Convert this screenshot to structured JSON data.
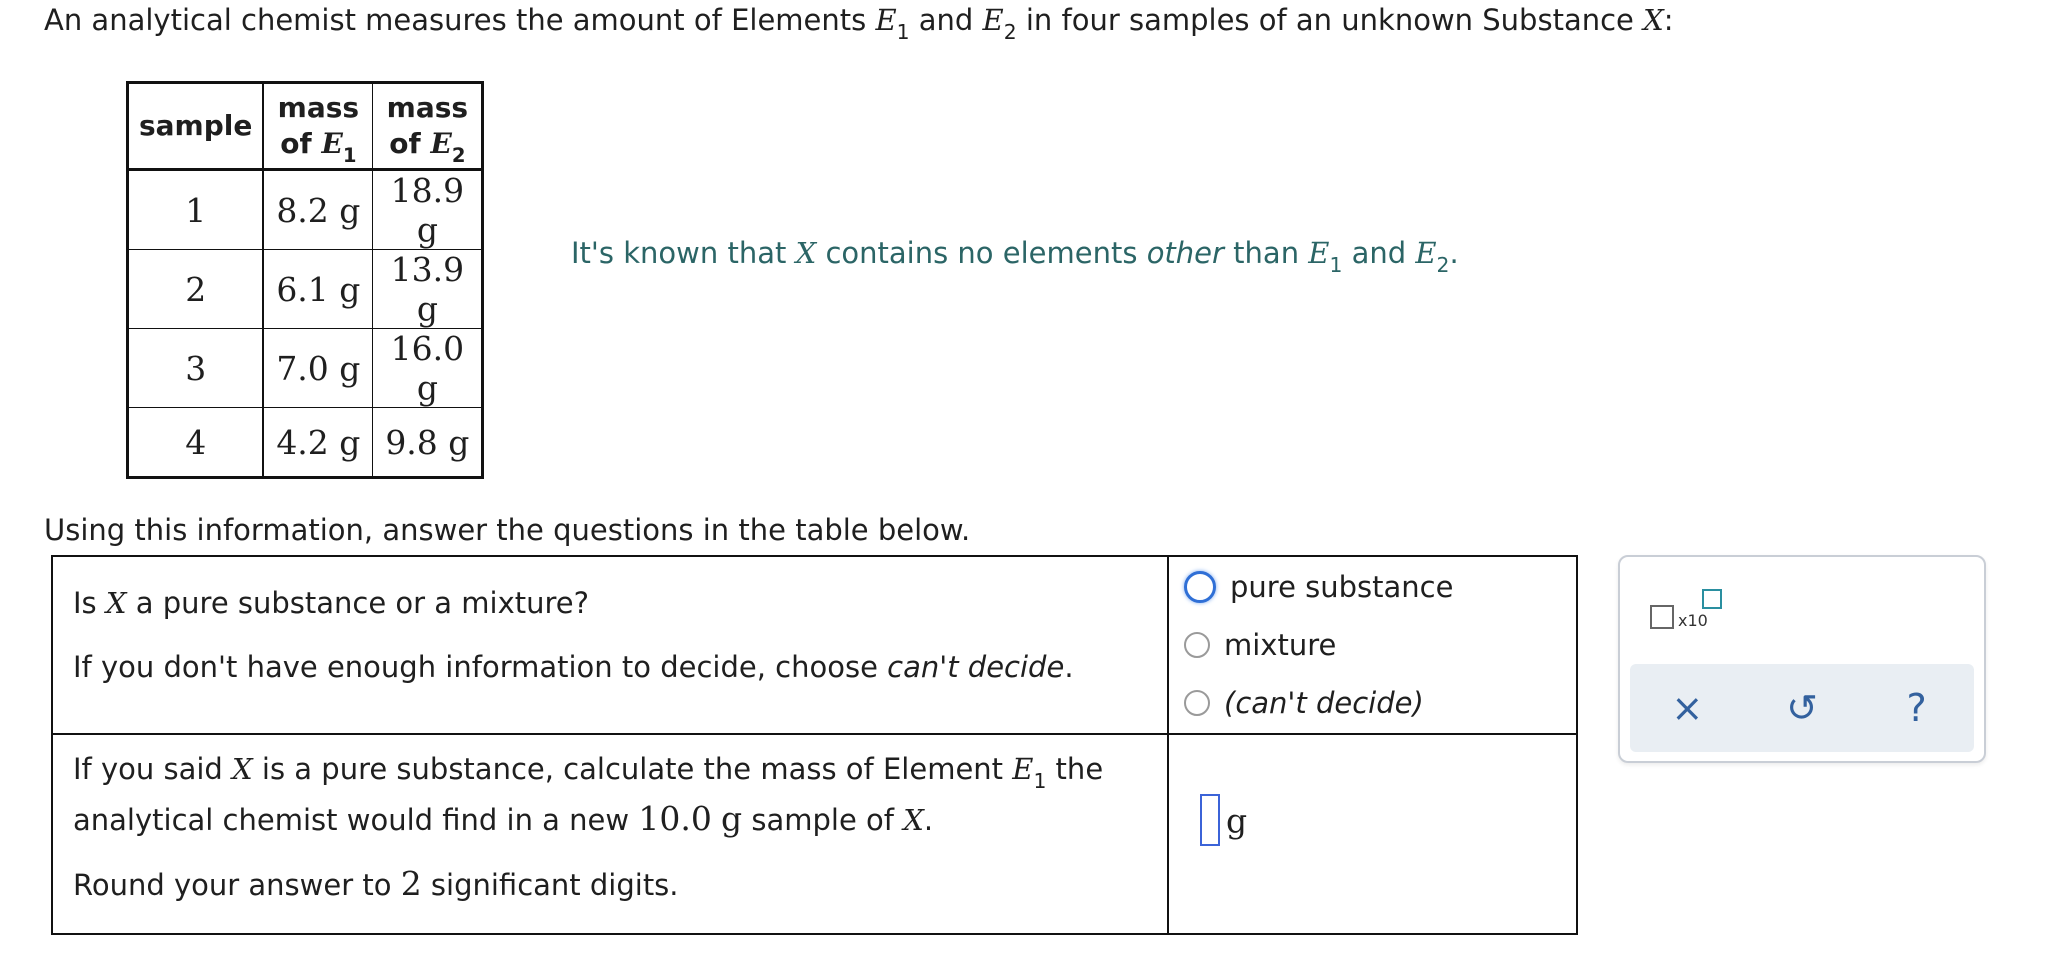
{
  "intro": {
    "p1": "An analytical chemist measures the amount of Elements ",
    "e1": "E",
    "s1": "1",
    "p2": " and ",
    "e2": "E",
    "s2": "2",
    "p3": " in four samples of an unknown Substance ",
    "x": "X",
    "p4": ":"
  },
  "data_table": {
    "header": {
      "sample": "sample",
      "mass1_top": "mass",
      "mass1_bottom": "of ",
      "e1": "E",
      "s1": "1",
      "mass2_top": "mass",
      "mass2_bottom": "of ",
      "e2": "E",
      "s2": "2"
    },
    "rows": [
      {
        "sample": "1",
        "e1": "8.2 g",
        "e2": "18.9 g"
      },
      {
        "sample": "2",
        "e1": "6.1 g",
        "e2": "13.9 g"
      },
      {
        "sample": "3",
        "e1": "7.0 g",
        "e2": "16.0 g"
      },
      {
        "sample": "4",
        "e1": "4.2 g",
        "e2": "9.8 g"
      }
    ]
  },
  "known": {
    "p1": "It's known that ",
    "x": "X",
    "p2": " contains no elements ",
    "other": "other",
    "p3": " than ",
    "e1": "E",
    "s1": "1",
    "p4": " and ",
    "e2": "E",
    "s2": "2",
    "p5": "."
  },
  "using": "Using this information, answer the questions in the table below.",
  "question1": {
    "line1_a": "Is ",
    "x": "X",
    "line1_b": " a pure substance or a mixture?",
    "line2_a": "If you don't have enough information to decide, choose ",
    "cant": "can't decide",
    "line2_b": "."
  },
  "options": [
    "pure substance",
    "mixture",
    "(can't decide)"
  ],
  "question2": {
    "l1_a": "If you said ",
    "x1": "X",
    "l1_b": " is a pure substance, calculate the mass of Element ",
    "e": "E",
    "s": "1",
    "l1_c": " the",
    "l2_a": "analytical chemist would find in a new ",
    "mass": "10.0",
    "g": "g",
    "l2_b": " sample of ",
    "x2": "X",
    "l2_c": ".",
    "l3_a": "Round your answer to ",
    "digits": "2",
    "l3_b": " significant digits."
  },
  "answer": {
    "unit": "g"
  },
  "tools": {
    "sci_label": "x10",
    "clear": "×",
    "undo": "↺",
    "help": "?"
  },
  "colors": {
    "teal_text": "#2b6566",
    "focus_blue": "#2f6fd6",
    "tool_blue": "#33619e"
  }
}
